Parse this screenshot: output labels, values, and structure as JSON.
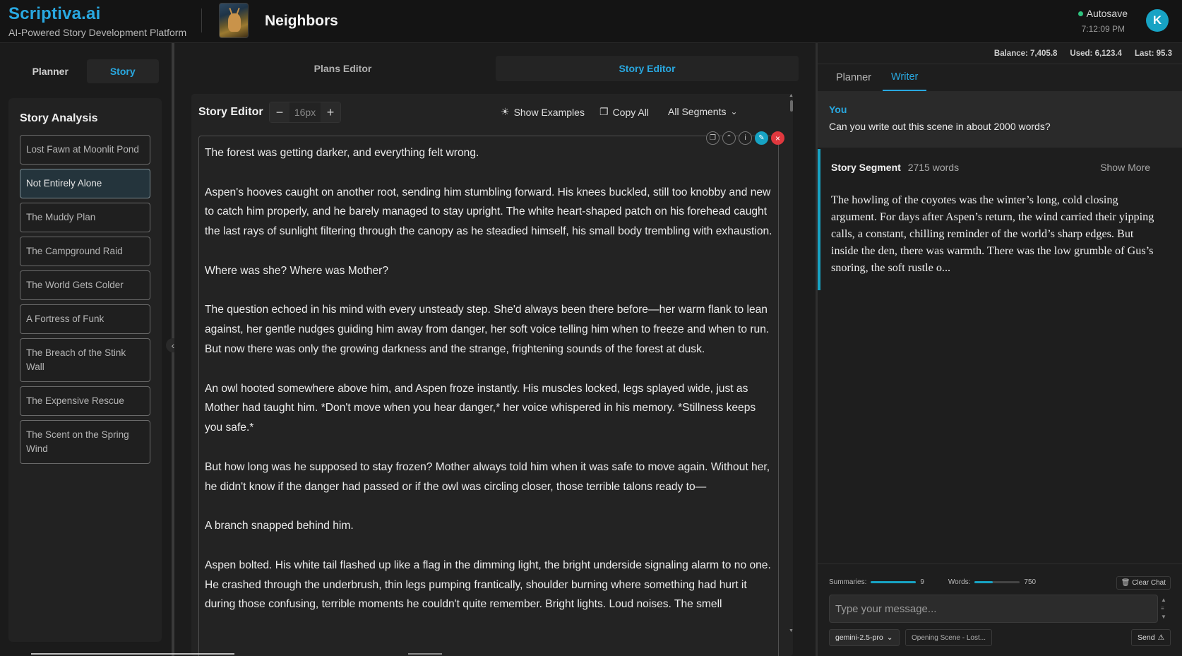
{
  "header": {
    "brand_name": "Scriptiva.ai",
    "brand_tagline": "AI-Powered Story Development Platform",
    "project_title": "Neighbors",
    "autosave_label": "Autosave",
    "autosave_time": "7:12:09 PM",
    "avatar_initial": "K",
    "accent_color": "#29a8e0",
    "autosave_status_color": "#2ec27e"
  },
  "left": {
    "tabs": [
      {
        "label": "Planner",
        "active": false
      },
      {
        "label": "Story",
        "active": true
      }
    ],
    "analysis_title": "Story Analysis",
    "segments": [
      {
        "label": "Lost Fawn at Moonlit Pond",
        "active": false
      },
      {
        "label": "Not Entirely Alone",
        "active": true
      },
      {
        "label": "The Muddy Plan",
        "active": false
      },
      {
        "label": "The Campground Raid",
        "active": false
      },
      {
        "label": "The World Gets Colder",
        "active": false
      },
      {
        "label": "A Fortress of Funk",
        "active": false
      },
      {
        "label": "The Breach of the Stink Wall",
        "active": false
      },
      {
        "label": "The Expensive Rescue",
        "active": false
      },
      {
        "label": "The Scent on the Spring Wind",
        "active": false
      }
    ]
  },
  "center": {
    "tabs": [
      {
        "label": "Plans Editor",
        "active": false
      },
      {
        "label": "Story Editor",
        "active": true
      }
    ],
    "editor_title": "Story Editor",
    "font_size": "16px",
    "show_examples_label": "Show Examples",
    "copy_all_label": "Copy All",
    "segments_dropdown_label": "All Segments",
    "paragraphs": [
      "The forest was getting darker, and everything felt wrong.",
      "Aspen's hooves caught on another root, sending him stumbling forward. His knees buckled, still too knobby and new to catch him properly, and he barely managed to stay upright. The white heart-shaped patch on his forehead caught the last rays of sunlight filtering through the canopy as he steadied himself, his small body trembling with exhaustion.",
      "Where was she? Where was Mother?",
      "The question echoed in his mind with every unsteady step. She'd always been there before—her warm flank to lean against, her gentle nudges guiding him away from danger, her soft voice telling him when to freeze and when to run. But now there was only the growing darkness and the strange, frightening sounds of the forest at dusk.",
      "An owl hooted somewhere above him, and Aspen froze instantly. His muscles locked, legs splayed wide, just as Mother had taught him. *Don't move when you hear danger,* her voice whispered in his memory. *Stillness keeps you safe.*",
      "But how long was he supposed to stay frozen? Mother always told him when it was safe to move again. Without her, he didn't know if the danger had passed or if the owl was circling closer, those terrible talons ready to—",
      "A branch snapped behind him.",
      "Aspen bolted. His white tail flashed up like a flag in the dimming light, the bright underside signaling alarm to no one. He crashed through the underbrush, thin legs pumping frantically, shoulder burning where something had hurt it during those confusing, terrible moments he couldn't quite remember. Bright lights. Loud noises. The smell"
    ]
  },
  "right": {
    "stats": {
      "balance": "Balance: 7,405.8",
      "used": "Used: 6,123.4",
      "last": "Last: 95.3"
    },
    "tabs": [
      {
        "label": "Planner",
        "active": false
      },
      {
        "label": "Writer",
        "active": true
      }
    ],
    "chat": {
      "you_label": "You",
      "you_message": "Can you write out this scene in about 2000 words?",
      "segment_label": "Story Segment",
      "segment_words": "2715 words",
      "show_more": "Show More",
      "segment_excerpt": "The howling of the coyotes was the winter’s long, cold closing argument. For days after Aspen’s return, the wind carried their yipping calls, a constant, chilling reminder of the world’s sharp edges. But inside the den, there was warmth. There was the low grumble of Gus’s snoring, the soft rustle o..."
    },
    "controls": {
      "summaries_label": "Summaries:",
      "summaries_value": "9",
      "summaries_fraction": 1.0,
      "words_label": "Words:",
      "words_value": "750",
      "words_fraction": 0.4,
      "clear_chat": "Clear Chat",
      "input_placeholder": "Type your message...",
      "model": "gemini-2.5-pro",
      "scene_chip": "Opening Scene - Lost...",
      "send_label": "Send"
    }
  }
}
